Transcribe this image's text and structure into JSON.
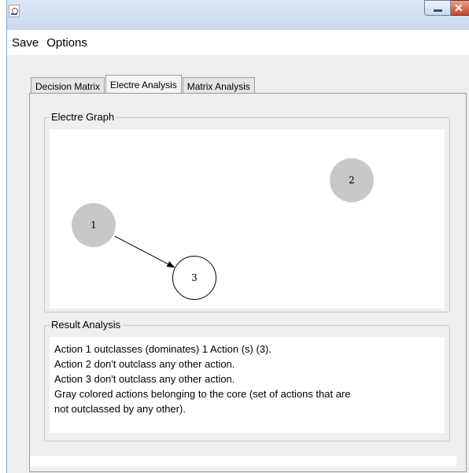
{
  "window": {
    "title": ""
  },
  "menu": {
    "items": [
      "Save",
      "Options"
    ]
  },
  "tabs": [
    {
      "label": "Decision Matrix",
      "active": false
    },
    {
      "label": "Electre Analysis",
      "active": true
    },
    {
      "label": "Matrix Analysis",
      "active": false
    }
  ],
  "graph": {
    "title": "Electre Graph",
    "nodes": [
      {
        "label": "1",
        "in_core": true
      },
      {
        "label": "2",
        "in_core": true
      },
      {
        "label": "3",
        "in_core": false
      }
    ],
    "edges": [
      {
        "from": "1",
        "to": "3"
      }
    ]
  },
  "results": {
    "title": "Result Analysis",
    "lines": [
      "Action 1 outclasses (dominates) 1 Action  (s) (3).",
      "Action 2 don't outclass any other action.",
      "Action 3 don't outclass any other action.",
      "Gray colored actions belonging to the core (set of actions that are",
      "not outclassed by any other)."
    ]
  },
  "colors": {
    "core_node": "#c8c8c8",
    "titlebar": "#d6e3f3",
    "close_button": "#c9462c"
  }
}
